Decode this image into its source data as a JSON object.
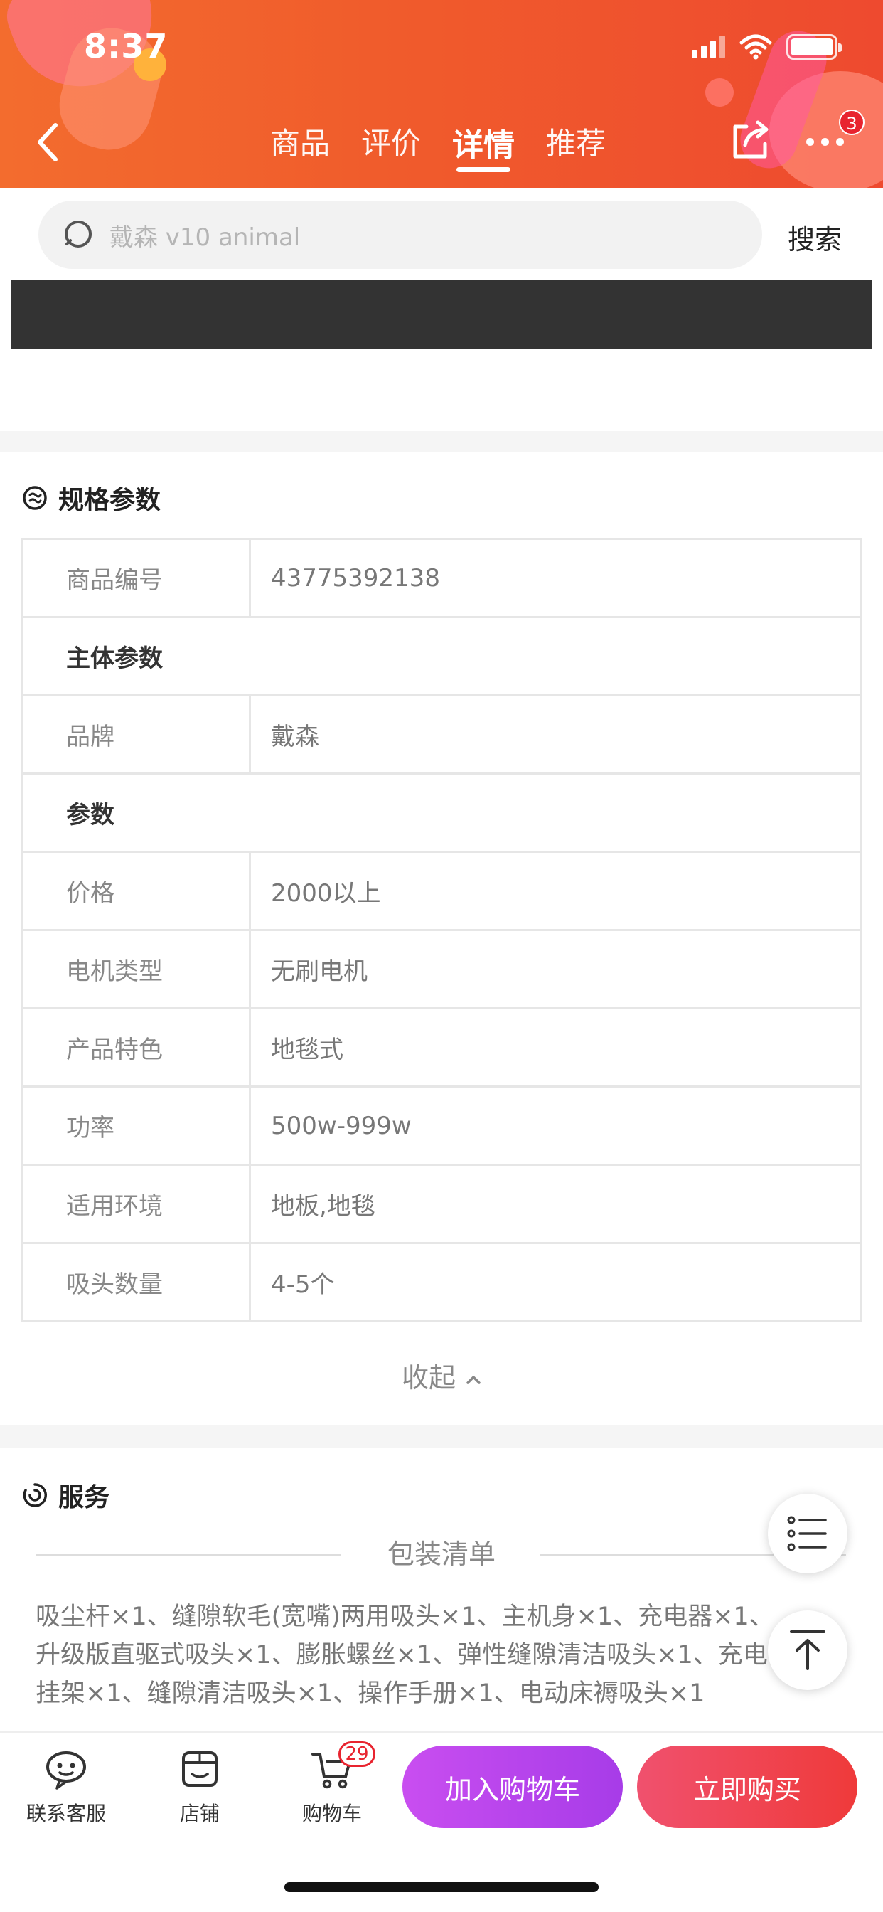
{
  "status_bar": {
    "time": "8:37"
  },
  "header": {
    "tabs": [
      {
        "label": "商品"
      },
      {
        "label": "评价"
      },
      {
        "label": "详情"
      },
      {
        "label": "推荐"
      }
    ],
    "active_tab": "详情",
    "more_badge": "3",
    "colors": {
      "header_start": "#f36c2e",
      "header_end": "#ee4a2f"
    }
  },
  "search": {
    "placeholder": "戴森 v10 animal",
    "button_label": "搜索"
  },
  "specs": {
    "title": "规格参数",
    "rows": [
      {
        "key": "商品编号",
        "value": "43775392138"
      },
      {
        "group": "主体参数"
      },
      {
        "key": "品牌",
        "value": "戴森"
      },
      {
        "group": "参数"
      },
      {
        "key": "价格",
        "value": "2000以上"
      },
      {
        "key": "电机类型",
        "value": "无刷电机"
      },
      {
        "key": "产品特色",
        "value": "地毯式"
      },
      {
        "key": "功率",
        "value": "500w-999w"
      },
      {
        "key": "适用环境",
        "value": "地板,地毯"
      },
      {
        "key": "吸头数量",
        "value": "4-5个"
      }
    ],
    "collapse_label": "收起"
  },
  "service": {
    "title": "服务",
    "packing_title": "包装清单",
    "packing_text": "吸尘杆×1、缝隙软毛(宽嘴)两用吸头×1、主机身×1、充电器×1、升级版直驱式吸头×1、膨胀螺丝×1、弹性缝隙清洁吸头×1、充电挂架×1、缝隙清洁吸头×1、操作手册×1、电动床褥吸头×1"
  },
  "bottom_bar": {
    "service_label": "联系客服",
    "store_label": "店铺",
    "cart_label": "购物车",
    "cart_count": "29",
    "add_to_cart": "加入购物车",
    "buy_now": "立即购买",
    "colors": {
      "add_to_cart": "#b845ec",
      "buy_now": "#ef4552"
    }
  }
}
